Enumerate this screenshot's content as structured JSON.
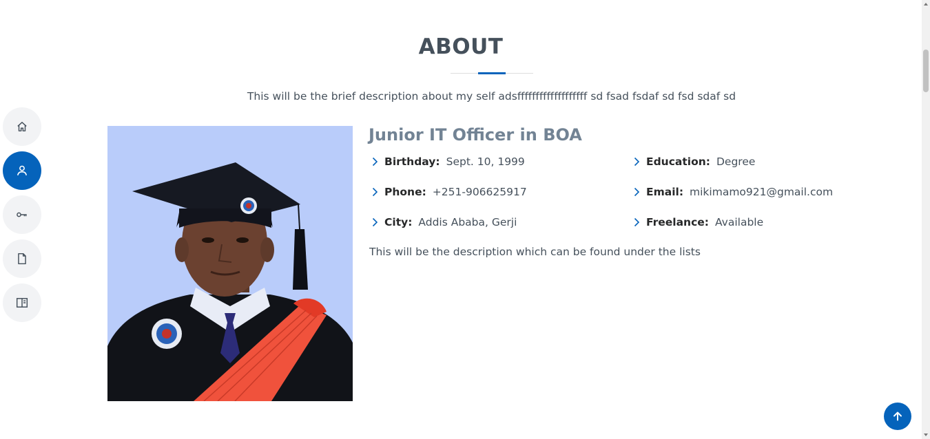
{
  "nav": {
    "items": [
      {
        "icon": "home-icon",
        "active": false
      },
      {
        "icon": "person-icon",
        "active": true
      },
      {
        "icon": "key-icon",
        "active": false
      },
      {
        "icon": "file-icon",
        "active": false
      },
      {
        "icon": "book-icon",
        "active": false
      }
    ]
  },
  "about": {
    "title": "ABOUT",
    "intro": "This will be the brief description about my self adsfffffffffffffffffff sd fsad fsdaf sd fsd sdaf sd",
    "job_title": "Junior IT Officer in BOA",
    "info": {
      "birthday_label": "Birthday:",
      "birthday_value": "Sept. 10, 1999",
      "phone_label": "Phone:",
      "phone_value": "+251-906625917",
      "city_label": "City:",
      "city_value": "Addis Ababa, Gerji",
      "education_label": "Education:",
      "education_value": "Degree",
      "email_label": "Email:",
      "email_value": "mikimamo921@gmail.com",
      "freelance_label": "Freelance:",
      "freelance_value": "Available"
    },
    "description": "This will be the description which can be found under the lists"
  },
  "colors": {
    "accent": "#0563bb",
    "title": "#45505b",
    "job_title": "#728394",
    "photo_bg": "#b9ccfa"
  },
  "back_to_top_icon": "arrow-up-icon"
}
